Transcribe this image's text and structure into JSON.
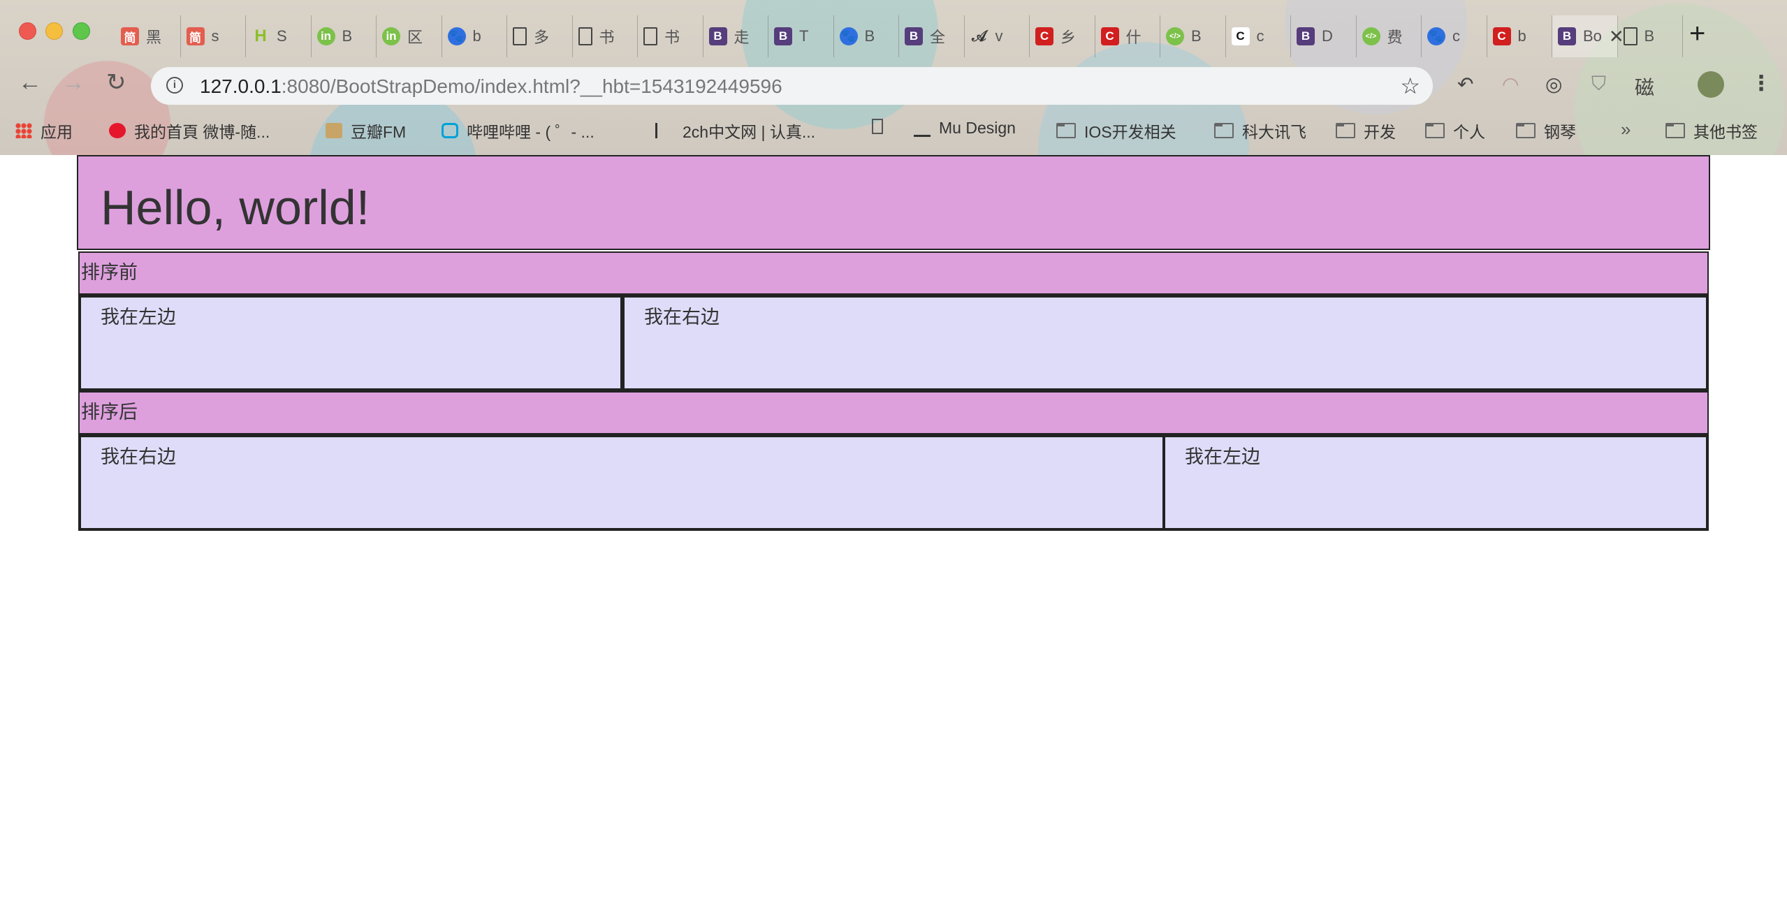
{
  "browser": {
    "tabs": [
      {
        "icon": "jian-icon",
        "text": "黑"
      },
      {
        "icon": "jian-icon",
        "text": "s"
      },
      {
        "icon": "h-icon",
        "text": "S"
      },
      {
        "icon": "green-icon",
        "text": "B"
      },
      {
        "icon": "green-icon",
        "text": "区"
      },
      {
        "icon": "baidu-paw-icon",
        "text": "b"
      },
      {
        "icon": "document-icon",
        "text": "多"
      },
      {
        "icon": "document-icon",
        "text": "书"
      },
      {
        "icon": "document-icon",
        "text": "书"
      },
      {
        "icon": "bootstrap-icon",
        "text": "走"
      },
      {
        "icon": "bootstrap-icon",
        "text": "T"
      },
      {
        "icon": "baidu-paw-icon",
        "text": "B"
      },
      {
        "icon": "bootstrap-icon",
        "text": "全"
      },
      {
        "icon": "signature-icon",
        "text": "v"
      },
      {
        "icon": "csdn-icon",
        "text": "乡"
      },
      {
        "icon": "csdn-icon",
        "text": "什"
      },
      {
        "icon": "code-icon",
        "text": "B"
      },
      {
        "icon": "c-white-icon",
        "text": "c"
      },
      {
        "icon": "bootstrap-icon",
        "text": "D"
      },
      {
        "icon": "code-icon",
        "text": "费"
      },
      {
        "icon": "baidu-paw-icon",
        "text": "c"
      },
      {
        "icon": "csdn-icon",
        "text": "b"
      },
      {
        "icon": "bootstrap-icon",
        "text": "Bo",
        "active": true
      },
      {
        "icon": "document-icon",
        "text": "B"
      }
    ],
    "url": {
      "host": "127.0.0.1",
      "rest": ":8080/BootStrapDemo/index.html?__hbt=1543192449596"
    },
    "extension_text": "磁",
    "bookmarks": [
      {
        "icon": "apps-grid-icon",
        "label": "应用"
      },
      {
        "icon": "weibo-icon",
        "label": "我的首頁 微博-随..."
      },
      {
        "icon": "douban-icon",
        "label": "豆瓣FM"
      },
      {
        "icon": "bilibili-icon",
        "label": "哔哩哔哩 - ( ゜- ..."
      },
      {
        "icon": "2ch-icon",
        "label": "2ch中文网 | 认真..."
      },
      {
        "icon": "document-icon",
        "label": ""
      },
      {
        "icon": "mu-icon",
        "label": "Mu Design"
      },
      {
        "icon": "folder-icon",
        "label": "IOS开发相关"
      },
      {
        "icon": "folder-icon",
        "label": "科大讯飞"
      },
      {
        "icon": "folder-icon",
        "label": "开发"
      },
      {
        "icon": "folder-icon",
        "label": "个人"
      },
      {
        "icon": "folder-icon",
        "label": "钢琴"
      }
    ],
    "more_bookmarks": "»",
    "other_bookmarks": "其他书签"
  },
  "page": {
    "heading": "Hello, world!",
    "before_label": "排序前",
    "before_left": "我在左边",
    "before_right": "我在右边",
    "after_label": "排序后",
    "after_first": "我在右边",
    "after_second": "我在左边"
  },
  "colors": {
    "jumbotron_bg": "#dda0dd",
    "column_bg": "#dedcf8",
    "border": "#222222"
  }
}
